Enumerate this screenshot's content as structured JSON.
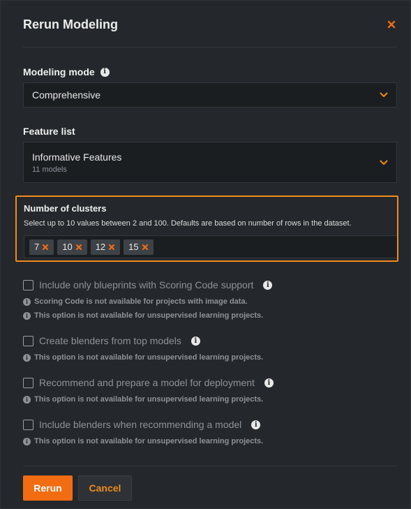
{
  "dialog": {
    "title": "Rerun Modeling",
    "close_icon": "close-icon"
  },
  "colors": {
    "accent": "#f26c12",
    "highlight_border": "#f08a1c",
    "background": "#24282c"
  },
  "modeling_mode": {
    "label": "Modeling mode",
    "value": "Comprehensive"
  },
  "feature_list": {
    "label": "Feature list",
    "value": "Informative Features",
    "sub": "11 models"
  },
  "clusters": {
    "label": "Number of clusters",
    "help": "Select up to 10 values between 2 and 100. Defaults are based on number of rows in the dataset.",
    "chips": [
      "7",
      "10",
      "12",
      "15"
    ]
  },
  "options": [
    {
      "label": "Include only blueprints with Scoring Code support",
      "checked": false,
      "notes": [
        "Scoring Code is not available for projects with image data.",
        "This option is not available for unsupervised learning projects."
      ]
    },
    {
      "label": "Create blenders from top models",
      "checked": false,
      "notes": [
        "This option is not available for unsupervised learning projects."
      ]
    },
    {
      "label": "Recommend and prepare a model for deployment",
      "checked": false,
      "notes": [
        "This option is not available for unsupervised learning projects."
      ]
    },
    {
      "label": "Include blenders when recommending a model",
      "checked": false,
      "notes": [
        "This option is not available for unsupervised learning projects."
      ]
    }
  ],
  "footer": {
    "rerun_label": "Rerun",
    "cancel_label": "Cancel"
  }
}
